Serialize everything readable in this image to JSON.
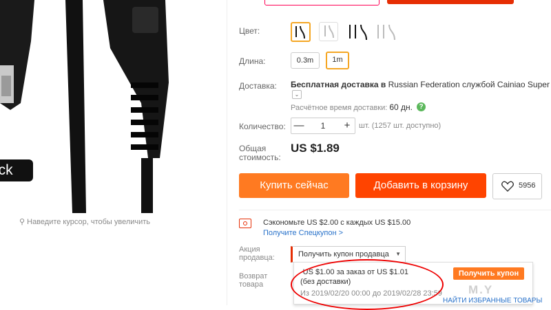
{
  "gallery": {
    "hover_hint": "Наведите курсор, чтобы увеличить",
    "black_label": "ack"
  },
  "options": {
    "color_label": "Цвет:",
    "length_label": "Длина:",
    "lengths": [
      "0.3m",
      "1m"
    ],
    "selected_length": "1m"
  },
  "delivery": {
    "label": "Доставка:",
    "text_bold": "Бесплатная доставка в",
    "text": "Russian Federation службой Cainiao Super Eco",
    "est_label": "Расчётное время доставки:",
    "est_value": "60 дн."
  },
  "quantity": {
    "label": "Количество:",
    "value": "1",
    "minus": "—",
    "plus": "+",
    "available": "шт. (1257 шт. доступно)"
  },
  "total": {
    "label_line1": "Общая",
    "label_line2": "стоимость:",
    "price": "US $1.89"
  },
  "actions": {
    "buy_now": "Купить сейчас",
    "add_to_cart": "Добавить в корзину",
    "wishlist_count": "5956"
  },
  "promo": {
    "save_text": "Сэкономьте US $2.00 с каждых US $15.00",
    "get_coupon_link": "Получите Спецкупон >",
    "seller_label_line1": "Акция",
    "seller_label_line2": "продавца:",
    "seller_coupon_button": "Получить купон продавца",
    "return_label_line1": "Возврат",
    "return_label_line2": "товара"
  },
  "coupon_dropdown": {
    "line1": "-US $1.00 за заказ от US $1.01",
    "line2": "(без доставки)",
    "line3": "Из 2019/02/20 00:00 до 2019/02/28 23:59",
    "get_button": "Получить купон",
    "bottom_link": "НАЙТИ ИЗБРАННЫЕ ТОВАРЫ"
  },
  "watermark": "M.Y",
  "colors": {
    "accent_orange": "#ff7a21",
    "cart_red": "#ff4400",
    "selected_border": "#f5a623",
    "link_blue": "#2670c9",
    "annotation_red": "#e00000"
  }
}
